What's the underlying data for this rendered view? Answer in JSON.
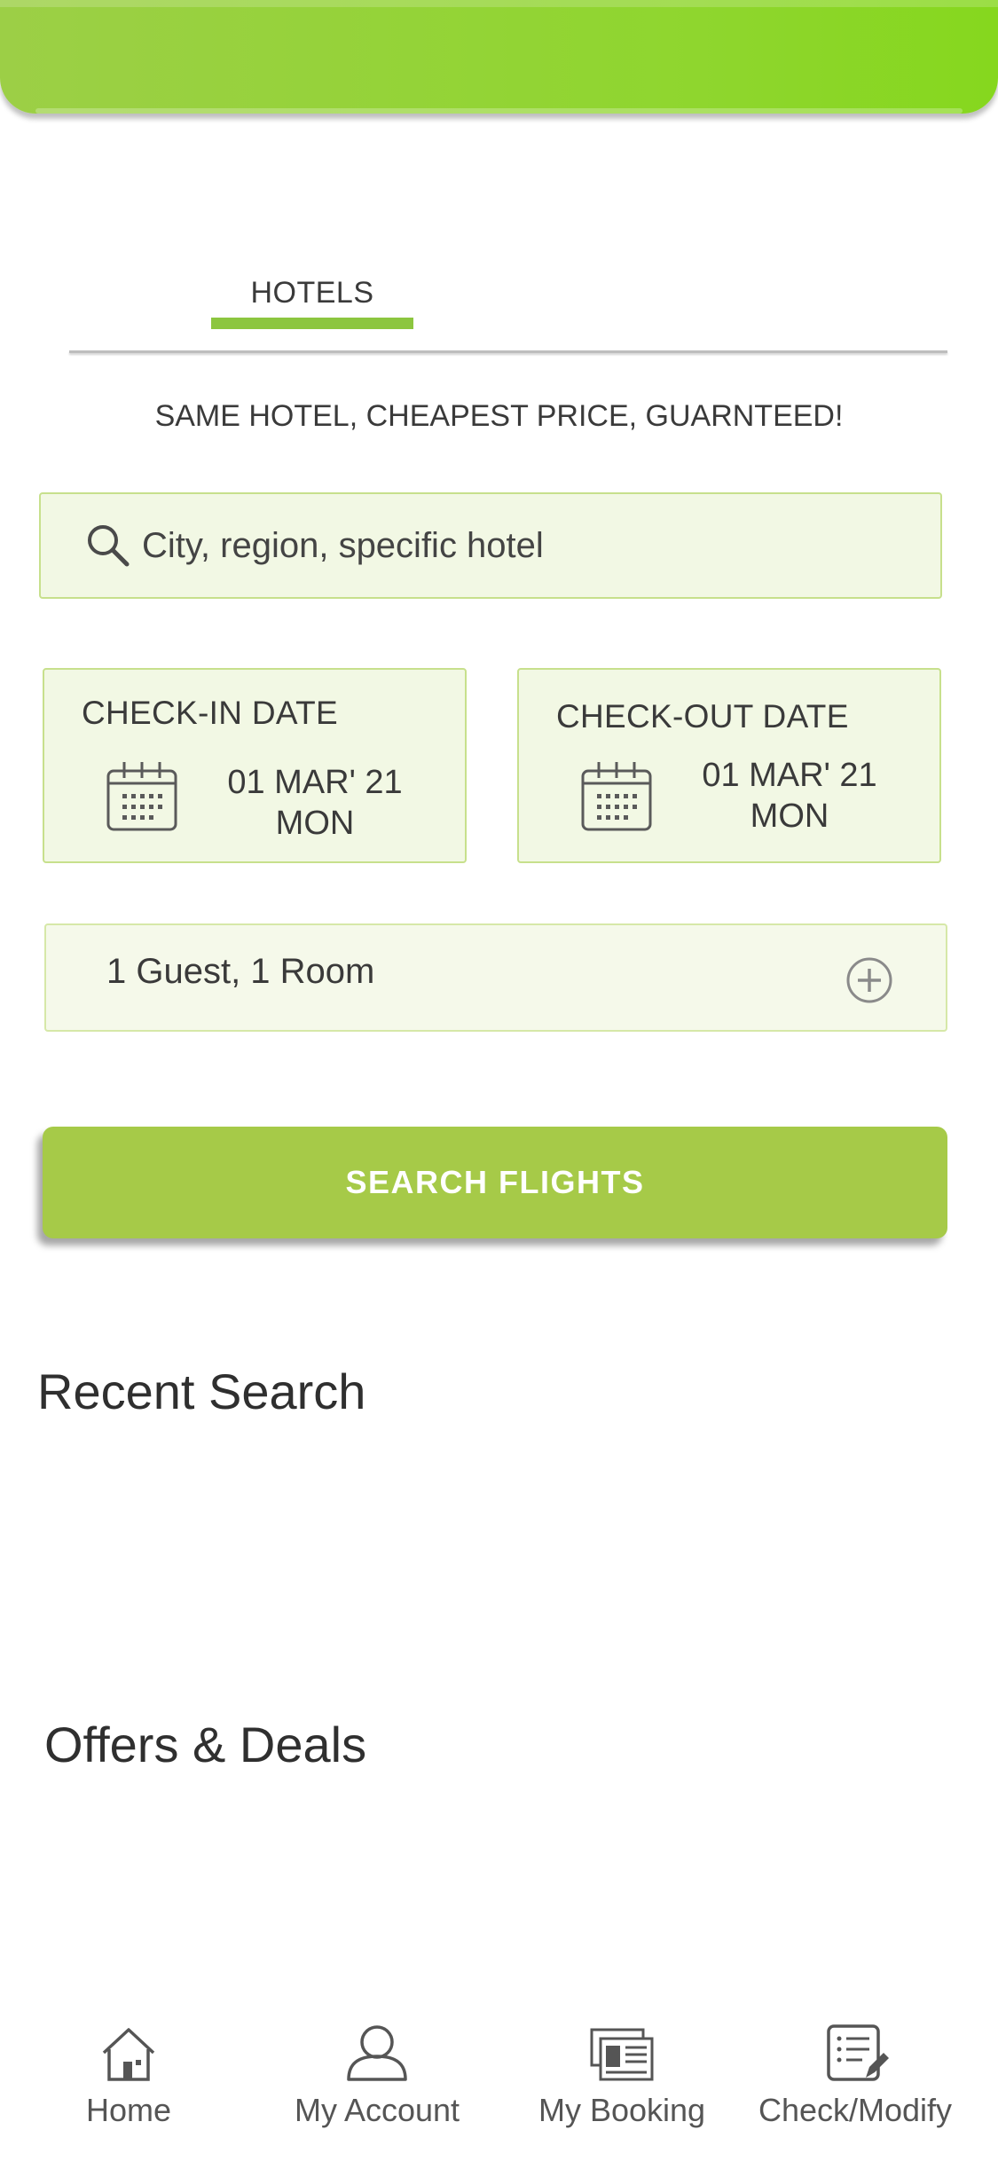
{
  "tabs": [
    {
      "label": "HOTELS",
      "active": true
    }
  ],
  "tagline": "SAME HOTEL, CHEAPEST PRICE, GUARNTEED!",
  "search": {
    "placeholder": "City, region, specific hotel",
    "icon": "search-icon"
  },
  "checkin": {
    "title": "CHECK-IN DATE",
    "date": "01 MAR' 21",
    "day": "MON",
    "icon": "calendar-icon"
  },
  "checkout": {
    "title": "CHECK-OUT DATE",
    "date": "01 MAR' 21",
    "day": "MON",
    "icon": "calendar-icon"
  },
  "guests": {
    "label": "1 Guest, 1 Room",
    "icon": "plus-circle-icon"
  },
  "search_button": "SEARCH FLIGHTS",
  "sections": {
    "recent": "Recent Search",
    "offers": "Offers & Deals"
  },
  "nav": [
    {
      "label": "Home",
      "icon": "home-icon"
    },
    {
      "label": "My Account",
      "icon": "account-icon"
    },
    {
      "label": "My Booking",
      "icon": "booking-icon"
    },
    {
      "label": "Check/Modify",
      "icon": "checklist-edit-icon"
    }
  ],
  "colors": {
    "accent": "#8cc63f",
    "header": "#8fd62e",
    "button": "#a6ca48",
    "field_bg": "#f2f8e4",
    "field_border": "#c7e08c"
  }
}
